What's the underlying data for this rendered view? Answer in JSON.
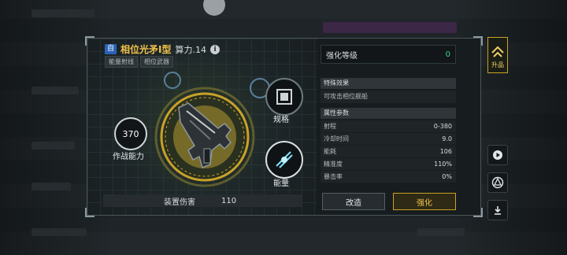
{
  "top_badge": "",
  "side": {
    "promote_label": "升品",
    "play_icon": "play-icon",
    "logo_icon": "emblem-icon",
    "download_icon": "download-icon"
  },
  "weapon": {
    "tag_self": "自",
    "name": "相位光矛Ⅰ型",
    "power": "算力.14",
    "info_icon": "i",
    "tags": [
      "能量射线",
      "相位武器"
    ],
    "combat_power_value": "370",
    "combat_power_label": "作战能力",
    "spec_label": "规格",
    "energy_label": "能量",
    "damage_label": "装置伤害",
    "damage_value": "110"
  },
  "enhance": {
    "level_label": "强化等级",
    "level_value": "0"
  },
  "special": {
    "title": "特殊效果",
    "text": "可攻击相位舰船"
  },
  "attributes": {
    "title": "属性参数",
    "rows": [
      {
        "k": "射程",
        "v": "0-380"
      },
      {
        "k": "冷却时间",
        "v": "9.0"
      },
      {
        "k": "能耗",
        "v": "106"
      },
      {
        "k": "精准度",
        "v": "110%"
      },
      {
        "k": "暴击率",
        "v": "0%"
      }
    ]
  },
  "buttons": {
    "modify": "改造",
    "enhance": "强化"
  },
  "colors": {
    "accent_gold": "#f2c34a",
    "level_green": "#38d28a",
    "self_tag_blue": "#2a63b5"
  }
}
